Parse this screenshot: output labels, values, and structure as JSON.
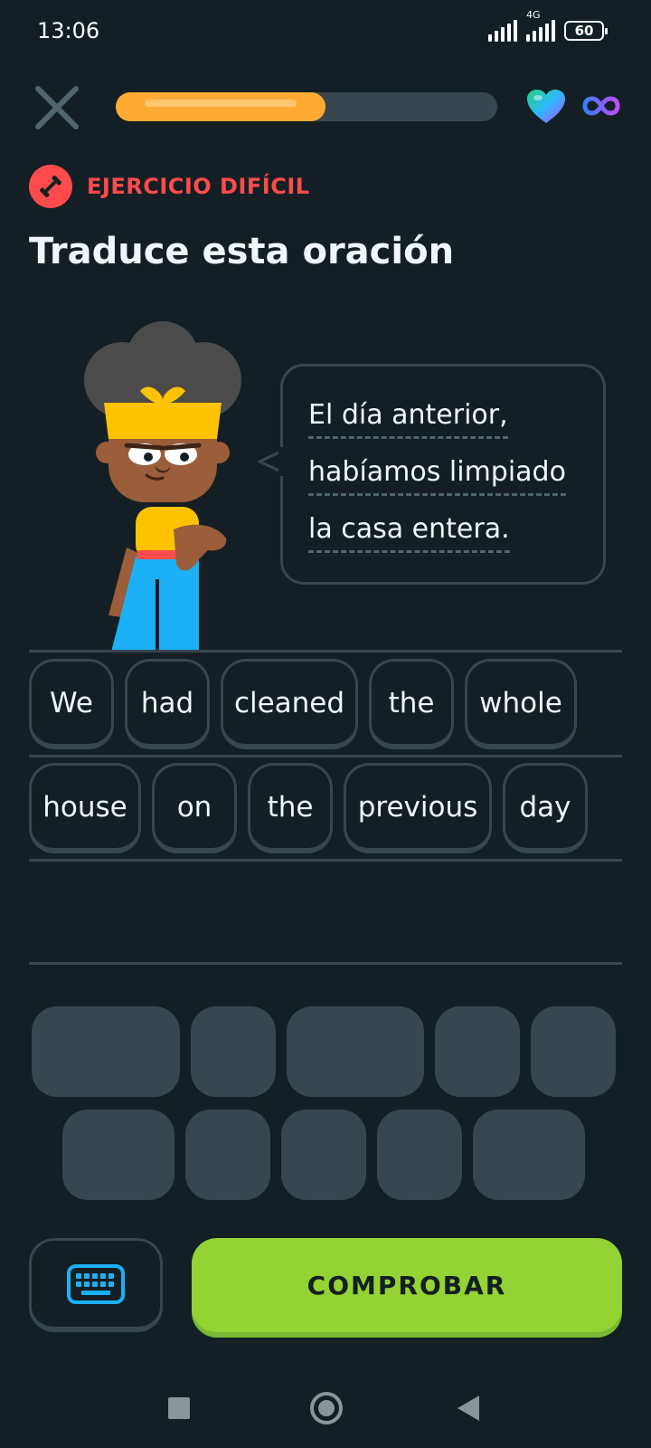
{
  "status_bar": {
    "time": "13:06",
    "network": "4G",
    "battery": "60"
  },
  "header": {
    "progress_percent": 0.55,
    "close_icon": "close-x-icon",
    "heart_icon": "heart-icon",
    "hearts_icon": "infinity-icon"
  },
  "badge": {
    "label": "EJERCICIO DIFÍCIL",
    "icon": "dumbbell-icon",
    "color": "#ff4b4b"
  },
  "title": "Traduce esta oración",
  "prompt": {
    "lines": [
      "El día anterior,",
      "habíamos limpiado",
      "la casa entera."
    ]
  },
  "answer": {
    "row1": [
      "We",
      "had",
      "cleaned",
      "the",
      "whole"
    ],
    "row2": [
      "house",
      "on",
      "the",
      "previous",
      "day"
    ]
  },
  "word_bank": {
    "row1_count": 5,
    "row2_count": 5
  },
  "actions": {
    "keyboard_icon": "keyboard-icon",
    "check_label": "COMPROBAR"
  },
  "colors": {
    "background": "#131f24",
    "accent_green": "#93d333",
    "progress": "#ffab33",
    "border": "#37464f"
  }
}
